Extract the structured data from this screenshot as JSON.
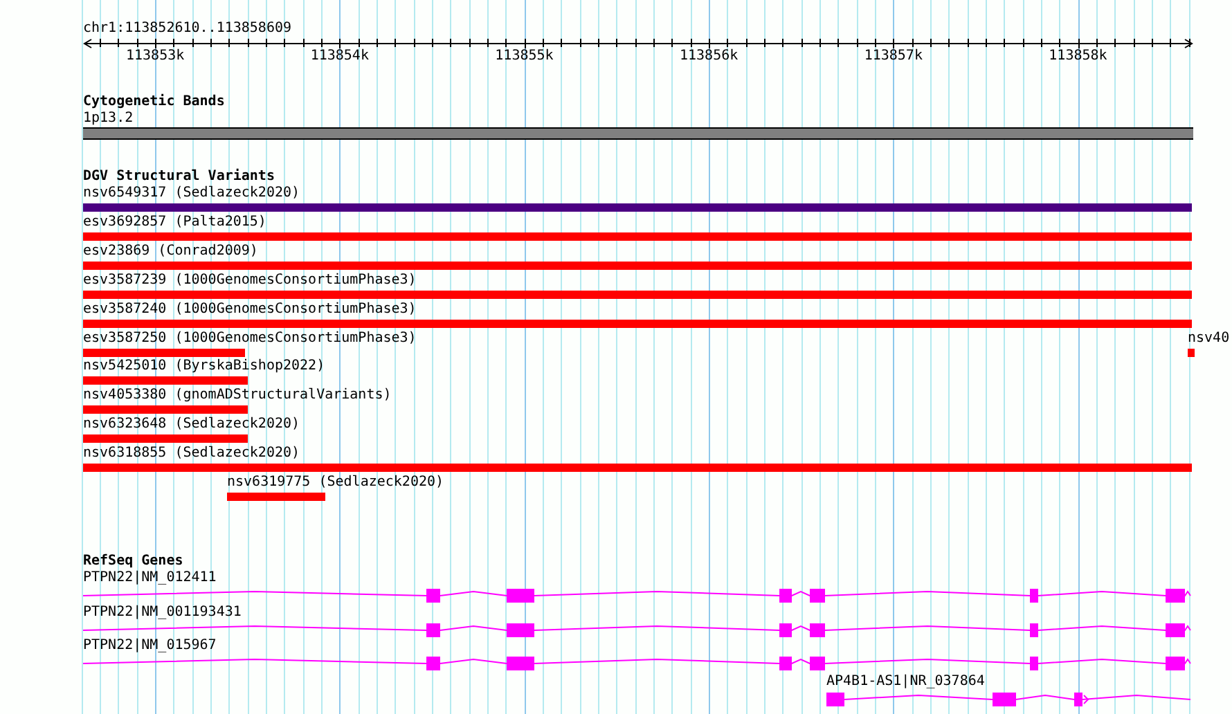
{
  "ruler": {
    "region": "chr1:113852610..113858609",
    "ticks": [
      "113853k",
      "113854k",
      "113855k",
      "113856k",
      "113857k",
      "113858k"
    ]
  },
  "tracks": [
    {
      "kind": "bands",
      "title": "Cytogenetic Bands",
      "features": [
        {
          "label": "1p13.2",
          "color": "#808080"
        }
      ]
    },
    {
      "kind": "variants",
      "title": "DGV Structural Variants",
      "features": [
        {
          "label": "nsv6549317 (Sedlazeck2020)",
          "color": "#4b0082"
        },
        {
          "label": "esv3692857 (Palta2015)",
          "color": "#ff0000"
        },
        {
          "label": "esv23869 (Conrad2009)",
          "color": "#ff0000"
        },
        {
          "label": "esv3587239 (1000GenomesConsortiumPhase3)",
          "color": "#ff0000"
        },
        {
          "label": "esv3587240 (1000GenomesConsortiumPhase3)",
          "color": "#ff0000"
        },
        {
          "label": "esv3587250 (1000GenomesConsortiumPhase3)",
          "color": "#ff0000"
        },
        {
          "label": "nsv40",
          "color": "#ff0000"
        },
        {
          "label": "nsv5425010 (ByrskaBishop2022)",
          "color": "#ff0000"
        },
        {
          "label": "nsv4053380 (gnomADStructuralVariants)",
          "color": "#ff0000"
        },
        {
          "label": "nsv6323648 (Sedlazeck2020)",
          "color": "#ff0000"
        },
        {
          "label": "nsv6318855 (Sedlazeck2020)",
          "color": "#ff0000"
        },
        {
          "label": "nsv6319775 (Sedlazeck2020)",
          "color": "#ff0000"
        }
      ]
    },
    {
      "kind": "genes",
      "title": "RefSeq Genes",
      "features": [
        {
          "label": "PTPN22|NM_012411",
          "color": "#ff00ff"
        },
        {
          "label": "PTPN22|NM_001193431",
          "color": "#ff00ff"
        },
        {
          "label": "PTPN22|NM_015967",
          "color": "#ff00ff"
        },
        {
          "label": "AP4B1-AS1|NR_037864",
          "color": "#ff00ff"
        }
      ]
    }
  ]
}
